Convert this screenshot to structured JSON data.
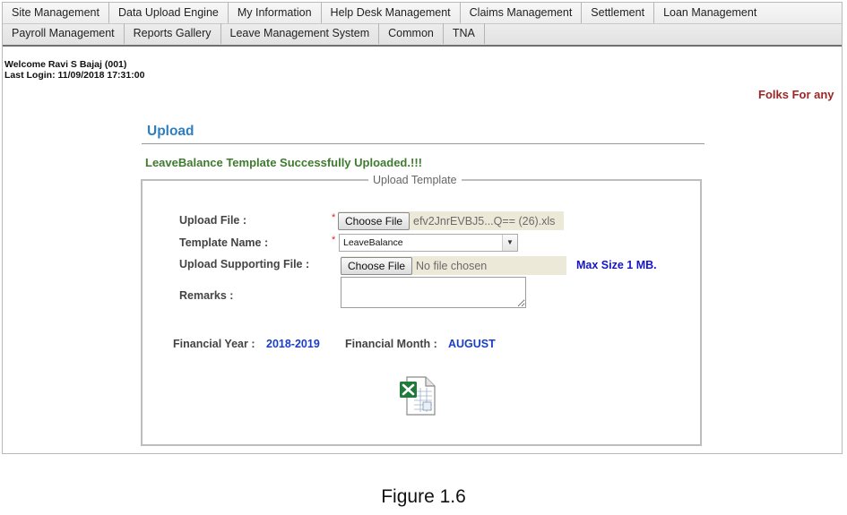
{
  "menu": {
    "row1": [
      "Site Management",
      "Data Upload Engine",
      "My Information",
      "Help Desk Management",
      "Claims Management",
      "Settlement",
      "Loan Management"
    ],
    "row2": [
      "Payroll Management",
      "Reports Gallery",
      "Leave Management System",
      "Common",
      "TNA"
    ]
  },
  "welcome": {
    "line1": "Welcome Ravi S Bajaj (001)",
    "line2": "Last Login: 11/09/2018 17:31:00"
  },
  "marquee_text": "Folks For any",
  "page": {
    "title": "Upload",
    "success_message": "LeaveBalance Template Successfully Uploaded.!!!"
  },
  "form": {
    "legend": "Upload Template",
    "required_mark": "*",
    "upload_file_label": "Upload File   :",
    "upload_file_button": "Choose File",
    "upload_file_name": "efv2JnrEVBJ5...Q== (26).xls",
    "template_name_label": "Template Name   :",
    "template_name_value": "LeaveBalance",
    "supporting_file_label": "Upload Supporting File   :",
    "supporting_file_button": "Choose File",
    "supporting_file_name": "No file chosen",
    "max_size": "Max Size 1 MB.",
    "remarks_label": "Remarks :",
    "remarks_value": ""
  },
  "period": {
    "financial_year_label": "Financial Year :",
    "financial_year_value": "2018-2019",
    "financial_month_label": "Financial Month :",
    "financial_month_value": "AUGUST"
  },
  "icons": {
    "download_template": "excel-file-icon",
    "select_arrow": "chevron-down-icon"
  },
  "colors": {
    "title": "#2f7fbf",
    "success": "#3f7b2f",
    "value_blue": "#1a3ec4",
    "marquee": "#9c2626"
  },
  "caption": "Figure 1.6"
}
